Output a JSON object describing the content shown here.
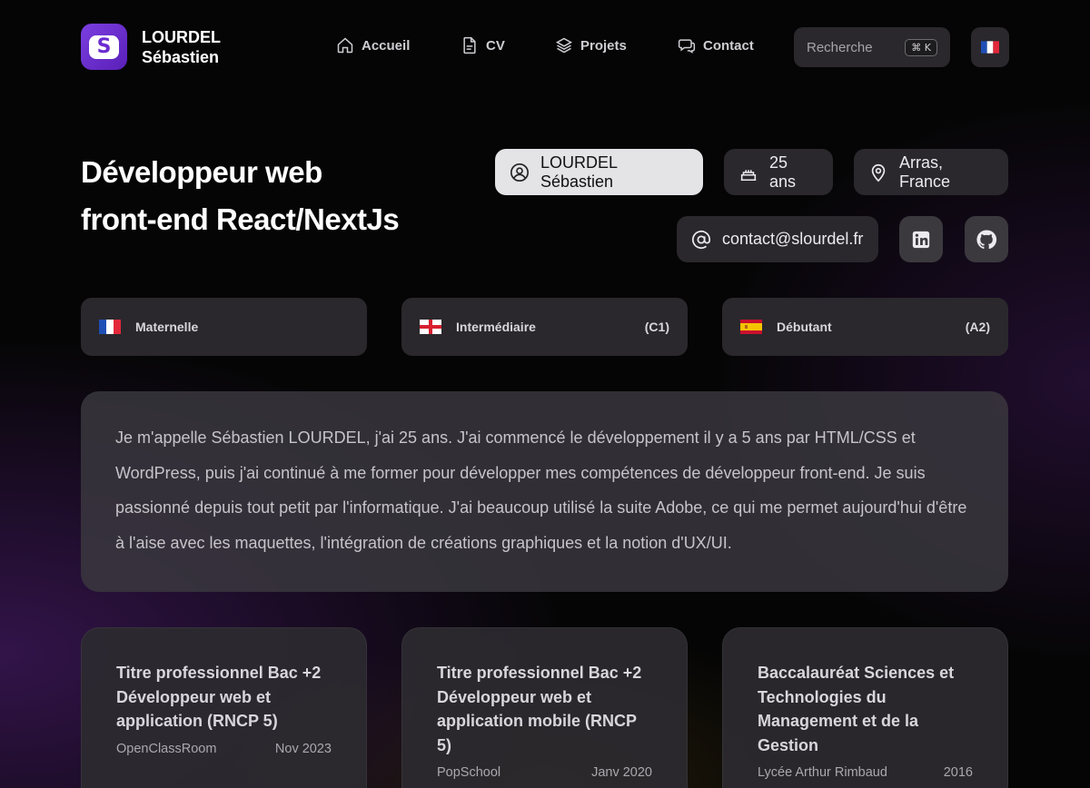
{
  "header": {
    "brand_line1": "LOURDEL",
    "brand_line2": "Sébastien",
    "logo_letter": "S",
    "nav": [
      {
        "label": "Accueil",
        "icon": "home-icon"
      },
      {
        "label": "CV",
        "icon": "file-icon"
      },
      {
        "label": "Projets",
        "icon": "layers-icon"
      },
      {
        "label": "Contact",
        "icon": "chat-icon"
      }
    ],
    "search_label": "Recherche",
    "search_shortcut": "⌘ K",
    "current_language_icon": "flag-fr-icon"
  },
  "hero": {
    "title_line1": "Développeur web",
    "title_line2": "front-end React/NextJs",
    "name": "LOURDEL Sébastien",
    "age": "25 ans",
    "location": "Arras, France",
    "email": "contact@slourdel.fr",
    "social": [
      "linkedin-icon",
      "github-icon"
    ]
  },
  "languages": [
    {
      "flag": "flag-fr-icon",
      "label": "Maternelle",
      "level": ""
    },
    {
      "flag": "flag-en-icon",
      "label": "Intermédiaire",
      "level": "(C1)"
    },
    {
      "flag": "flag-es-icon",
      "label": "Débutant",
      "level": "(A2)"
    }
  ],
  "bio": {
    "text": "Je m'appelle Sébastien LOURDEL, j'ai 25 ans. J'ai commencé le développement il y a 5 ans par HTML/CSS et WordPress, puis j'ai continué à me former pour développer mes compétences de développeur front-end. Je suis passionné depuis tout petit par l'informatique. J'ai beaucoup utilisé la suite Adobe, ce qui me permet aujourd'hui d'être à l'aise avec les maquettes, l'intégration de créations graphiques et la notion d'UX/UI."
  },
  "education": [
    {
      "title": "Titre professionnel Bac +2 Développeur web et application (RNCP 5)",
      "school": "OpenClassRoom",
      "date": "Nov 2023"
    },
    {
      "title": "Titre professionnel Bac +2 Développeur web et application mobile (RNCP 5)",
      "school": "PopSchool",
      "date": "Janv 2020"
    },
    {
      "title": "Baccalauréat Sciences et Technologies du Management et de la Gestion",
      "school": "Lycée Arthur Rimbaud",
      "date": "2016"
    }
  ]
}
